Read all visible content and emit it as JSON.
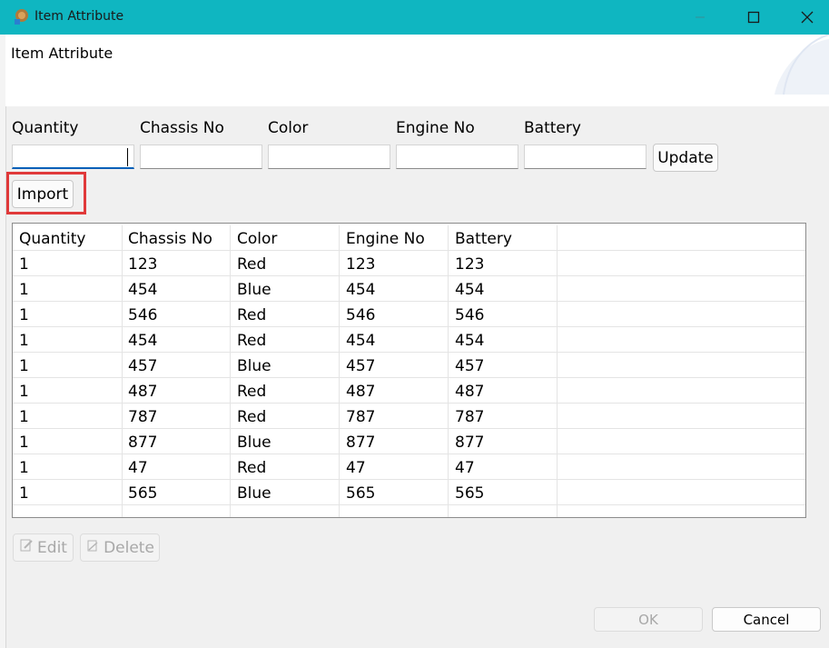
{
  "window": {
    "title": "Item Attribute",
    "controls": [
      "minimize",
      "maximize",
      "close"
    ]
  },
  "header": {
    "title": "Item Attribute"
  },
  "form": {
    "fields": [
      {
        "label": "Quantity",
        "value": ""
      },
      {
        "label": "Chassis No",
        "value": ""
      },
      {
        "label": "Color",
        "value": ""
      },
      {
        "label": "Engine No",
        "value": ""
      },
      {
        "label": "Battery",
        "value": ""
      }
    ],
    "update_label": "Update",
    "import_label": "Import"
  },
  "grid": {
    "columns": [
      "Quantity",
      "Chassis No",
      "Color",
      "Engine No",
      "Battery"
    ],
    "rows": [
      [
        "1",
        "123",
        "Red",
        "123",
        "123"
      ],
      [
        "1",
        "454",
        "Blue",
        "454",
        "454"
      ],
      [
        "1",
        "546",
        "Red",
        "546",
        "546"
      ],
      [
        "1",
        "454",
        "Red",
        "454",
        "454"
      ],
      [
        "1",
        "457",
        "Blue",
        "457",
        "457"
      ],
      [
        "1",
        "487",
        "Red",
        "487",
        "487"
      ],
      [
        "1",
        "787",
        "Red",
        "787",
        "787"
      ],
      [
        "1",
        "877",
        "Blue",
        "877",
        "877"
      ],
      [
        "1",
        "47",
        "Red",
        "47",
        "47"
      ],
      [
        "1",
        "565",
        "Blue",
        "565",
        "565"
      ]
    ]
  },
  "actions": {
    "edit_label": "Edit",
    "delete_label": "Delete",
    "ok_label": "OK",
    "cancel_label": "Cancel"
  },
  "colors": {
    "titlebar": "#0fb6c1",
    "highlight": "#e0393a",
    "focus": "#005fb8"
  }
}
